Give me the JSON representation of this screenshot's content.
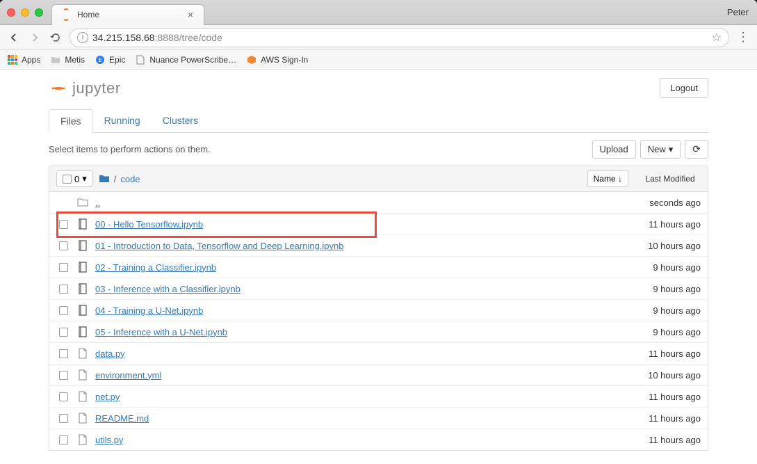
{
  "window": {
    "username": "Peter",
    "tab_title": "Home"
  },
  "browser": {
    "url_host": "34.215.158.68",
    "url_port_path": ":8888/tree/code",
    "bookmarks": {
      "apps": "Apps",
      "metis": "Metis",
      "epic": "Epic",
      "nuance": "Nuance PowerScribe…",
      "aws": "AWS Sign-In"
    }
  },
  "jupyter": {
    "logo_text": "jupyter",
    "logout": "Logout",
    "tabs": {
      "files": "Files",
      "running": "Running",
      "clusters": "Clusters"
    },
    "select_text": "Select items to perform actions on them.",
    "upload": "Upload",
    "new": "New",
    "count": "0",
    "breadcrumb_current": "code",
    "name_col": "Name",
    "lastmod_col": "Last Modified",
    "files": [
      {
        "type": "parent",
        "name": "..",
        "modified": "seconds ago"
      },
      {
        "type": "notebook",
        "name": "00 - Hello Tensorflow.ipynb",
        "modified": "11 hours ago",
        "highlight": true
      },
      {
        "type": "notebook",
        "name": "01 - Introduction to Data, Tensorflow and Deep Learning.ipynb",
        "modified": "10 hours ago"
      },
      {
        "type": "notebook",
        "name": "02 - Training a Classifier.ipynb",
        "modified": "9 hours ago"
      },
      {
        "type": "notebook",
        "name": "03 - Inference with a Classifier.ipynb",
        "modified": "9 hours ago"
      },
      {
        "type": "notebook",
        "name": "04 - Training a U-Net.ipynb",
        "modified": "9 hours ago"
      },
      {
        "type": "notebook",
        "name": "05 - Inference with a U-Net.ipynb",
        "modified": "9 hours ago"
      },
      {
        "type": "file",
        "name": "data.py",
        "modified": "11 hours ago"
      },
      {
        "type": "file",
        "name": "environment.yml",
        "modified": "10 hours ago"
      },
      {
        "type": "file",
        "name": "net.py",
        "modified": "11 hours ago"
      },
      {
        "type": "file",
        "name": "README.md",
        "modified": "11 hours ago"
      },
      {
        "type": "file",
        "name": "utils.py",
        "modified": "11 hours ago"
      }
    ]
  }
}
